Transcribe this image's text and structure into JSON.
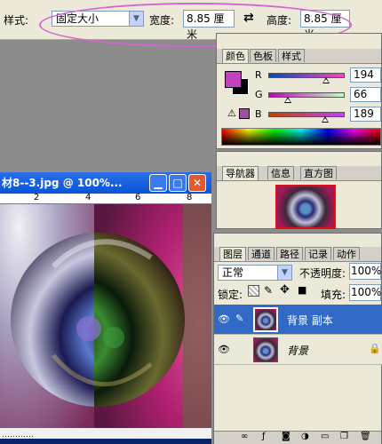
{
  "options_bar": {
    "style_label": "样式:",
    "style_value": "固定大小",
    "width_label": "宽度:",
    "width_value": "8.85 厘米",
    "height_label": "高度:",
    "height_value": "8.85 厘米",
    "swap_glyph": "⇄"
  },
  "color_panel": {
    "tabs": [
      "颜色",
      "色板",
      "样式"
    ],
    "channels": [
      {
        "label": "R",
        "value": "194",
        "level": 0.76
      },
      {
        "label": "G",
        "value": "66",
        "level": 0.26
      },
      {
        "label": "B",
        "value": "189",
        "level": 0.74
      }
    ],
    "foreground": "#c242bd",
    "background": "#000000",
    "warning_swatch": "#a050a0"
  },
  "navigator_panel": {
    "tabs": [
      "导航器",
      "信息",
      "直方图"
    ]
  },
  "document": {
    "title": "材8--3.jpg @ 100%...",
    "ruler_marks": [
      "2",
      "4",
      "6",
      "8"
    ],
    "bottom_text": "…………"
  },
  "layers_panel": {
    "tabs": [
      "图层",
      "通道",
      "路径",
      "记录",
      "动作"
    ],
    "blend_mode": "正常",
    "opacity_label": "不透明度:",
    "opacity_value": "100%",
    "lock_label": "锁定:",
    "fill_label": "填充:",
    "fill_value": "100%",
    "layers": [
      {
        "name": "背景 副本",
        "selected": true
      },
      {
        "name": "背景",
        "selected": false
      }
    ]
  },
  "colors": {
    "selection_ellipse": "#d565d5",
    "layer_selected": "#316ac5",
    "title_bar": "#0a54d8"
  }
}
